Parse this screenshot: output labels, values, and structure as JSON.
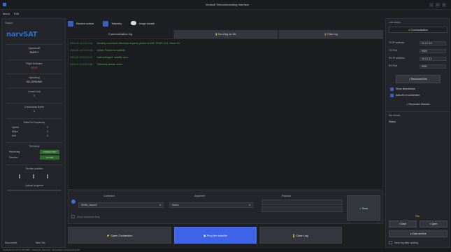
{
  "window": {
    "title": "Ventsoft Telecommanding Interface"
  },
  "menu": {
    "items": [
      "Menu",
      "Edit"
    ]
  },
  "left": {
    "header": "Status",
    "logo_text": "narvSAT",
    "sections": [
      {
        "label": "Spacecraft",
        "value": "RNSS-1"
      },
      {
        "label": "Flight Software",
        "value": "SEND"
      },
      {
        "label": "Operating",
        "value": "NO-GROUND"
      },
      {
        "label": "Comm Link",
        "value": "1"
      },
      {
        "label": "Commands Buffer",
        "value": "1"
      },
      {
        "label": "Data Rx Frequency",
        "value": ""
      }
    ],
    "rx_rows": [
      {
        "k": "Uplink",
        "v": "1"
      },
      {
        "k": "Mbps",
        "v": "1"
      },
      {
        "k": "Ack",
        "v": "1"
      }
    ],
    "telemetry_label": "Telemetry",
    "telemetry_rows": [
      {
        "k": "Receiving",
        "v": "CONNECTED"
      },
      {
        "k": "Session",
        "v": "ACTIVE"
      }
    ],
    "scroller_label": "Scroller position",
    "progress_label": "Upload progress",
    "footer": [
      "Disconnect",
      "New Tab"
    ]
  },
  "top": {
    "receive_label": "Receive content",
    "telemetry_label": "Telemetry",
    "image_label": "Image transfer"
  },
  "tabs": {
    "items": [
      {
        "label": "Communication log"
      },
      {
        "label": "Sending as file"
      },
      {
        "label": "Filter log"
      }
    ]
  },
  "log": {
    "rows": [
      {
        "ts": "2024-01-14 10:12:44",
        "text": "Sending command: telemetry request, packet id 0x3F, RNSS CH1, frame OK"
      },
      {
        "ts": "2024-01-14 10:12:45",
        "text": "Uplink: Packet for satellite"
      },
      {
        "ts": "2024-01-14 10:12:47",
        "text": "Acknowledged: satellite sync"
      },
      {
        "ts": "2024-01-14 10:12:50",
        "text": "Telemetry stream active"
      }
    ]
  },
  "send": {
    "headers": [
      "Command",
      "Argument",
      "Payload"
    ],
    "command_value": "SEND_IMAGE",
    "argument_value": "RNSS",
    "payload_placeholder": "",
    "options_label": "Show command help",
    "send_label": "Send"
  },
  "actions": {
    "left_label": "Open Connection",
    "center_label": "Ping the satellite",
    "right_label": "Clear Log"
  },
  "right": {
    "header": "Link status",
    "tab_label": "Communication",
    "rows": [
      {
        "k": "TX IP address",
        "v": "10.0.1.10"
      },
      {
        "k": "TX Port",
        "v": "9000"
      },
      {
        "k": "RX IP address",
        "v": "10.0.1.11"
      },
      {
        "k": "RX Port",
        "v": "9001"
      }
    ],
    "connect_label": "Reconnect link",
    "options": [
      "Show timestamps",
      "Auto-fill on connection"
    ],
    "reset_label": "Reconnect Session",
    "details_header": "Set details",
    "details_value": "Status",
    "footer": {
      "title": "File",
      "buttons": [
        "Save",
        "Open",
        "Scan archive"
      ],
      "checkbox_label": "Save log after quitting"
    }
  },
  "status": {
    "text": "Connected to 10.0.1.10:9000 - waiting for telemetry - last packet received 10:12:50"
  }
}
